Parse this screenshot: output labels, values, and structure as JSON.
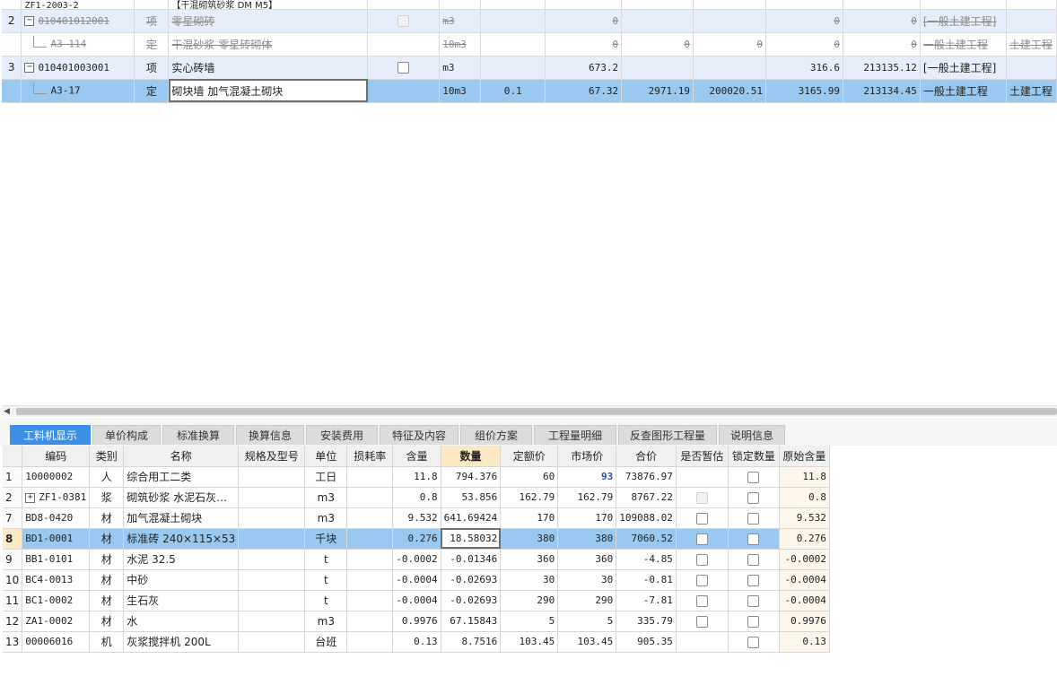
{
  "top_rows": [
    {
      "no": "",
      "code": "ZF1-2003-2",
      "type": "",
      "name": "【干混砌筑砂浆 DM M5】",
      "unit": "",
      "qty": "",
      "amount": "",
      "price": "",
      "total": "",
      "c1": "",
      "c2": "",
      "c3": "",
      "spec": "",
      "style": "white",
      "strike": false,
      "partial": true
    },
    {
      "no": "2",
      "code": "010401012001",
      "type": "项",
      "name": "零星砌砖",
      "unit": "m3",
      "qty": "",
      "amount": "0",
      "price": "",
      "total": "",
      "c1": "0",
      "c2": "0",
      "c3": "[一般土建工程]",
      "spec": "",
      "style": "light",
      "strike": true,
      "tree": "box",
      "checkbox": "disabled"
    },
    {
      "no": "",
      "code": "A3-114",
      "type": "定",
      "name": "干混砂浆 零星砖砌体",
      "unit": "10m3",
      "qty": "",
      "amount": "0",
      "price": "0",
      "total": "0",
      "c1": "0",
      "c2": "0",
      "c3": "一般土建工程",
      "spec": "土建工程",
      "style": "white",
      "strike": true,
      "tree": "leaf"
    },
    {
      "no": "3",
      "code": "010401003001",
      "type": "项",
      "name": "实心砖墙",
      "unit": "m3",
      "qty": "",
      "amount": "673.2",
      "price": "",
      "total": "",
      "c1": "316.6",
      "c2": "213135.12",
      "c3": "[一般土建工程]",
      "spec": "",
      "style": "light",
      "strike": false,
      "tree": "box",
      "checkbox": "enabled"
    },
    {
      "no": "",
      "code": "A3-17",
      "type": "定",
      "name": "砌块墙 加气混凝土砌块",
      "unit": "10m3",
      "qty": "0.1",
      "amount": "67.32",
      "price": "2971.19",
      "total": "200020.51",
      "c1": "3165.99",
      "c2": "213134.45",
      "c3": "一般土建工程",
      "spec": "土建工程",
      "style": "sel",
      "strike": false,
      "tree": "leaf",
      "editing": true
    }
  ],
  "tabs": [
    {
      "label": "工料机显示",
      "active": true
    },
    {
      "label": "单价构成"
    },
    {
      "label": "标准换算"
    },
    {
      "label": "换算信息"
    },
    {
      "label": "安装费用"
    },
    {
      "label": "特征及内容"
    },
    {
      "label": "组价方案"
    },
    {
      "label": "工程量明细"
    },
    {
      "label": "反查图形工程量"
    },
    {
      "label": "说明信息"
    }
  ],
  "bottom": {
    "headers": [
      "",
      "编码",
      "类别",
      "名称",
      "规格及型号",
      "单位",
      "损耗率",
      "含量",
      "数量",
      "定额价",
      "市场价",
      "合价",
      "是否暂估",
      "锁定数量",
      "原始含量"
    ],
    "rows": [
      {
        "no": "1",
        "code": "10000002",
        "cat": "人",
        "name": "综合用工二类",
        "spec": "",
        "unit": "工日",
        "loss": "",
        "content": "11.8",
        "qty": "794.376",
        "quota": "60",
        "market": "93",
        "total": "73876.97",
        "est": "none",
        "lock": "box",
        "orig": "11.8",
        "market_hl": true
      },
      {
        "no": "2",
        "code": "ZF1-0381",
        "cat": "浆",
        "name": "砌筑砂浆 水泥石灰…",
        "spec": "",
        "unit": "m3",
        "loss": "",
        "content": "0.8",
        "qty": "53.856",
        "quota": "162.79",
        "market": "162.79",
        "total": "8767.22",
        "est": "disabled",
        "lock": "box",
        "orig": "0.8",
        "expand": true
      },
      {
        "no": "7",
        "code": "BD8-0420",
        "cat": "材",
        "name": "加气混凝土砌块",
        "spec": "",
        "unit": "m3",
        "loss": "",
        "content": "9.532",
        "qty": "641.69424",
        "quota": "170",
        "market": "170",
        "total": "109088.02",
        "est": "box",
        "lock": "box",
        "orig": "9.532"
      },
      {
        "no": "8",
        "code": "BD1-0001",
        "cat": "材",
        "name": "标准砖 240×115×53",
        "spec": "",
        "unit": "千块",
        "loss": "",
        "content": "0.276",
        "qty": "18.58032",
        "quota": "380",
        "market": "380",
        "total": "7060.52",
        "est": "box",
        "lock": "box",
        "orig": "0.276",
        "selected": true
      },
      {
        "no": "9",
        "code": "BB1-0101",
        "cat": "材",
        "name": "水泥 32.5",
        "spec": "",
        "unit": "t",
        "loss": "",
        "content": "-0.0002",
        "qty": "-0.01346",
        "quota": "360",
        "market": "360",
        "total": "-4.85",
        "est": "box",
        "lock": "box",
        "orig": "-0.0002"
      },
      {
        "no": "10",
        "code": "BC4-0013",
        "cat": "材",
        "name": "中砂",
        "spec": "",
        "unit": "t",
        "loss": "",
        "content": "-0.0004",
        "qty": "-0.02693",
        "quota": "30",
        "market": "30",
        "total": "-0.81",
        "est": "box",
        "lock": "box",
        "orig": "-0.0004"
      },
      {
        "no": "11",
        "code": "BC1-0002",
        "cat": "材",
        "name": "生石灰",
        "spec": "",
        "unit": "t",
        "loss": "",
        "content": "-0.0004",
        "qty": "-0.02693",
        "quota": "290",
        "market": "290",
        "total": "-7.81",
        "est": "box",
        "lock": "box",
        "orig": "-0.0004"
      },
      {
        "no": "12",
        "code": "ZA1-0002",
        "cat": "材",
        "name": "水",
        "spec": "",
        "unit": "m3",
        "loss": "",
        "content": "0.9976",
        "qty": "67.15843",
        "quota": "5",
        "market": "5",
        "total": "335.79",
        "est": "box",
        "lock": "box",
        "orig": "0.9976"
      },
      {
        "no": "13",
        "code": "00006016",
        "cat": "机",
        "name": "灰浆搅拌机 200L",
        "spec": "",
        "unit": "台班",
        "loss": "",
        "content": "0.13",
        "qty": "8.7516",
        "quota": "103.45",
        "market": "103.45",
        "total": "905.35",
        "est": "none",
        "lock": "box",
        "orig": "0.13"
      }
    ]
  },
  "colors": {
    "selected_row": "#99c9f1",
    "light_row": "#e6eefb",
    "active_tab": "#3d8fe6",
    "highlight_header": "#fde8c4"
  }
}
